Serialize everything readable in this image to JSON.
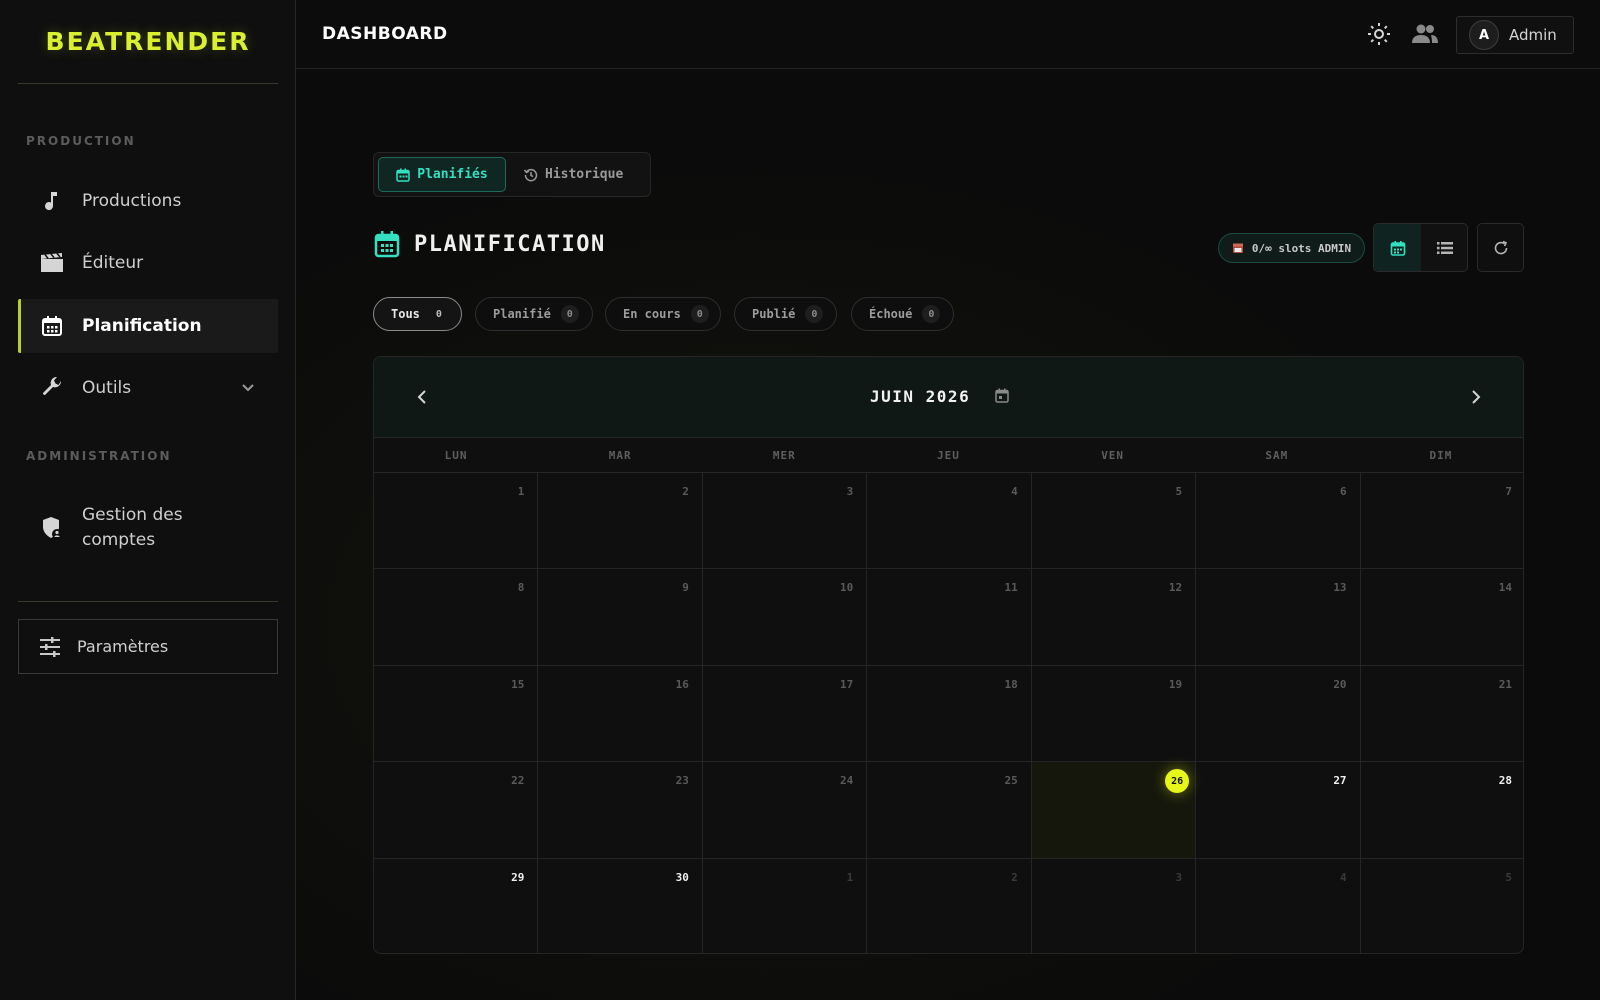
{
  "brand": {
    "name": "BEATRENDER",
    "color": "#d9ef2f"
  },
  "sidebar": {
    "section_production": "PRODUCTION",
    "section_admin": "ADMINISTRATION",
    "items": [
      {
        "label": "Productions",
        "icon": "music-note-icon"
      },
      {
        "label": "Éditeur",
        "icon": "clapperboard-icon"
      },
      {
        "label": "Planification",
        "icon": "calendar-icon",
        "active": true
      },
      {
        "label": "Outils",
        "icon": "wrench-icon"
      },
      {
        "label": "Gestion des comptes",
        "icon": "shield-user-icon"
      }
    ],
    "settings_label": "Paramètres"
  },
  "topbar": {
    "title": "DASHBOARD",
    "user_initial": "A",
    "user_name": "Admin"
  },
  "tabs": {
    "scheduled": "Planifiés",
    "history": "Historique"
  },
  "section": {
    "title": "PLANIFICATION",
    "slots": "0/∞ slots ADMIN"
  },
  "filters": [
    {
      "label": "Tous",
      "count": "0"
    },
    {
      "label": "Planifié",
      "count": "0"
    },
    {
      "label": "En cours",
      "count": "0"
    },
    {
      "label": "Publié",
      "count": "0"
    },
    {
      "label": "Échoué",
      "count": "0"
    }
  ],
  "calendar": {
    "month": "JUIN 2026",
    "weekdays": [
      "LUN",
      "MAR",
      "MER",
      "JEU",
      "VEN",
      "SAM",
      "DIM"
    ],
    "today": "26",
    "weeks": [
      [
        "1",
        "2",
        "3",
        "4",
        "5",
        "6",
        "7"
      ],
      [
        "8",
        "9",
        "10",
        "11",
        "12",
        "13",
        "14"
      ],
      [
        "15",
        "16",
        "17",
        "18",
        "19",
        "20",
        "21"
      ],
      [
        "22",
        "23",
        "24",
        "25",
        "26",
        "27",
        "28"
      ],
      [
        "29",
        "30",
        "1",
        "2",
        "3",
        "4",
        "5"
      ]
    ]
  },
  "colors": {
    "accent": "#34e0c2",
    "today": "#e6f51a",
    "sidebar_active_border": "#b7cf28"
  }
}
